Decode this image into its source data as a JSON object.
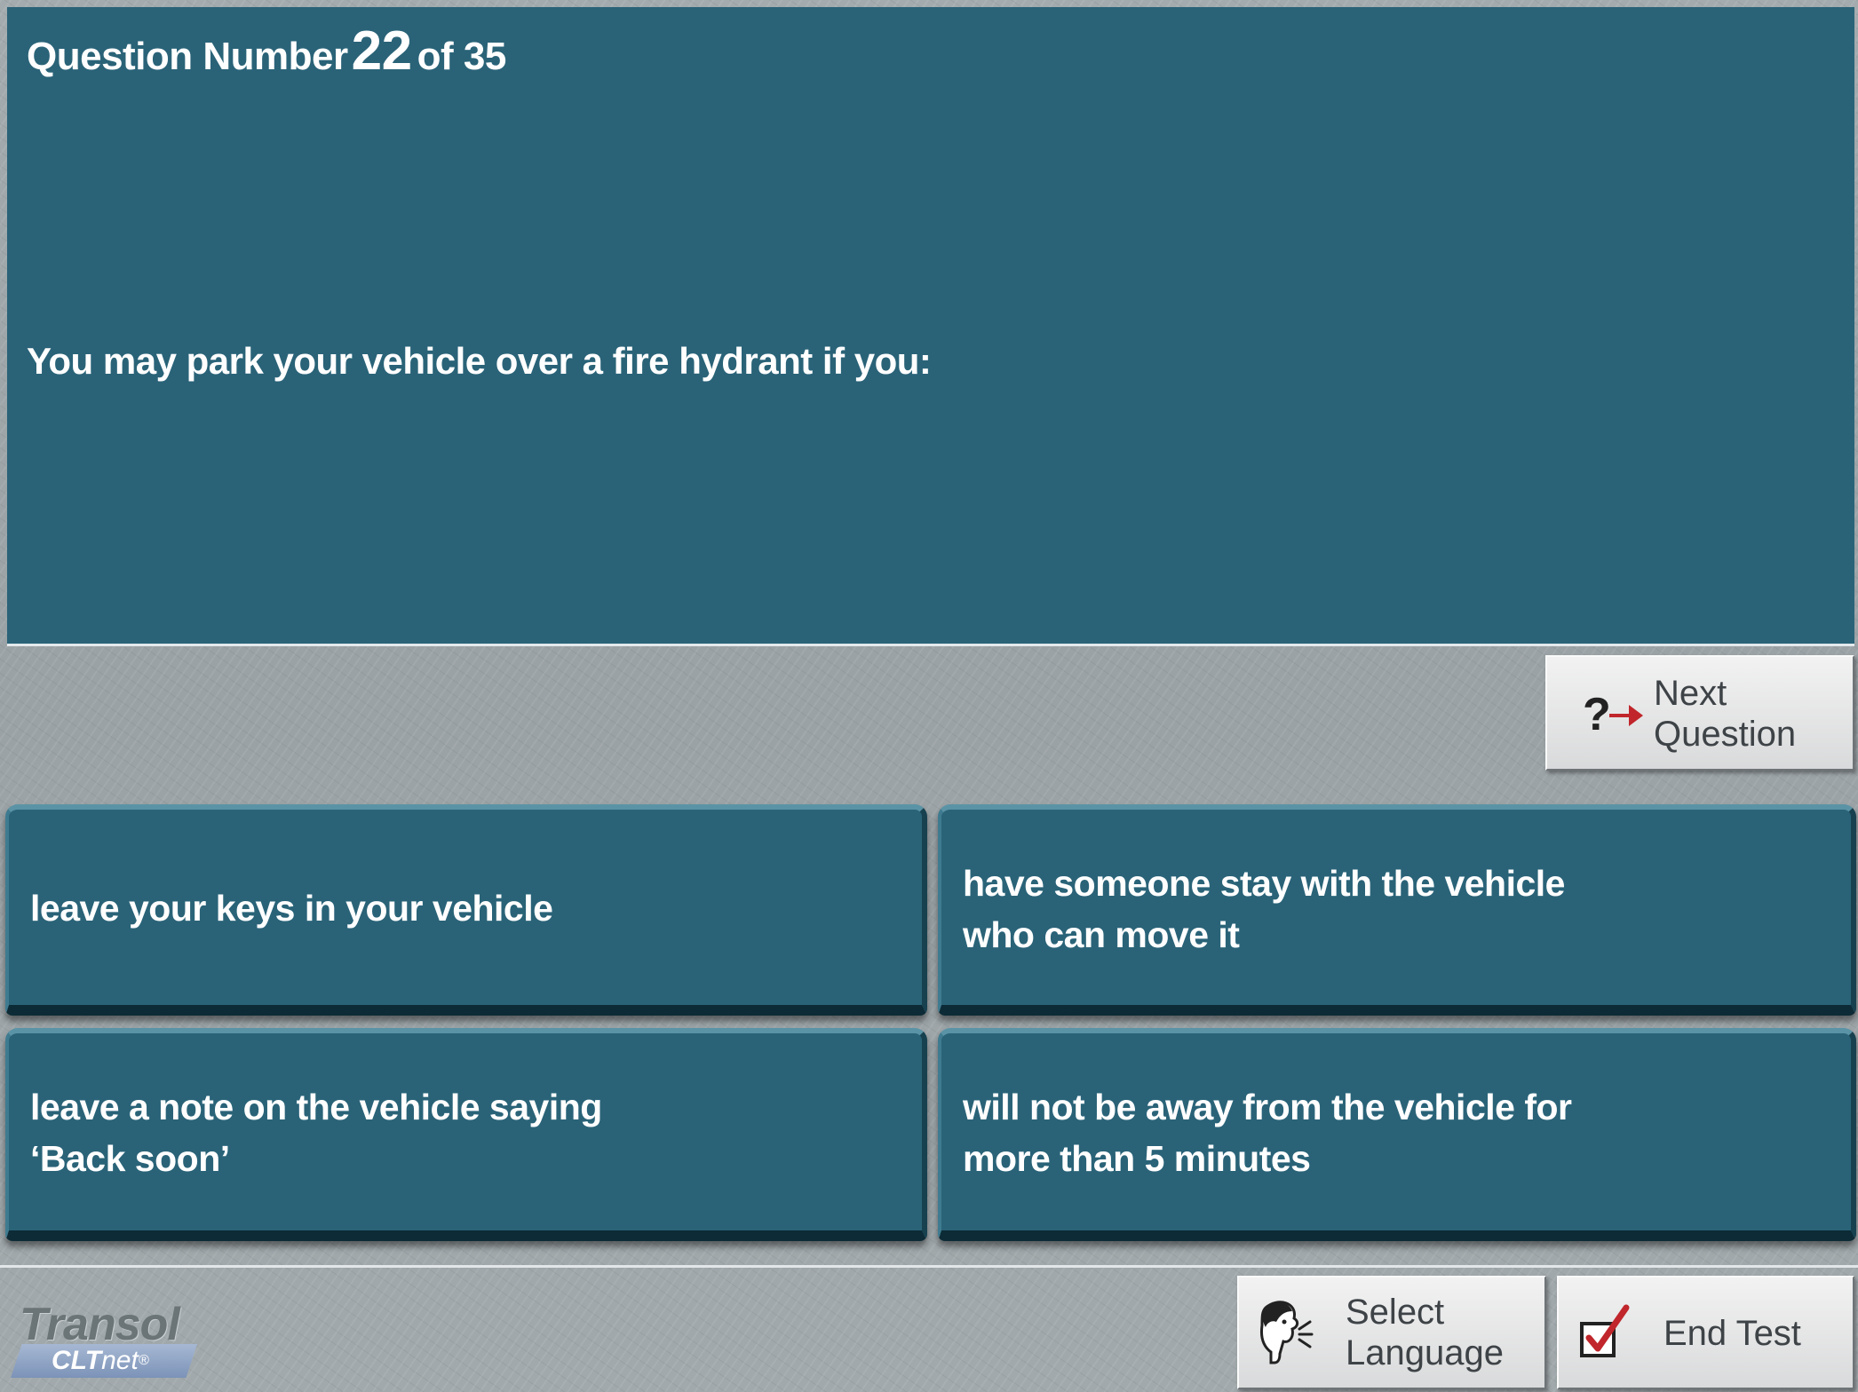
{
  "question": {
    "prefix": "Question Number",
    "number": "22",
    "suffix": "of 35",
    "text": "You may park your vehicle over a fire hydrant if you:"
  },
  "answers": [
    {
      "line1": "leave your keys in your vehicle",
      "line2": ""
    },
    {
      "line1": "have someone stay with the vehicle",
      "line2": "who can move it"
    },
    {
      "line1": "leave a note on the vehicle saying",
      "line2": "‘Back soon’"
    },
    {
      "line1": "will not be away from the vehicle for",
      "line2": "more than 5 minutes"
    }
  ],
  "buttons": {
    "next": {
      "line1": "Next",
      "line2": "Question",
      "icon": "question-arrow-icon"
    },
    "language": {
      "line1": "Select",
      "line2": "Language",
      "icon": "speaking-head-icon"
    },
    "end": {
      "label": "End Test",
      "icon": "checkbox-check-icon"
    }
  },
  "logo": {
    "brand": "Transol",
    "product_bold": "CLT",
    "product_rest": "net",
    "mark": "®"
  },
  "colors": {
    "panel": "#2a6378",
    "background": "#9aa3a6",
    "accent_red": "#c0262b"
  }
}
